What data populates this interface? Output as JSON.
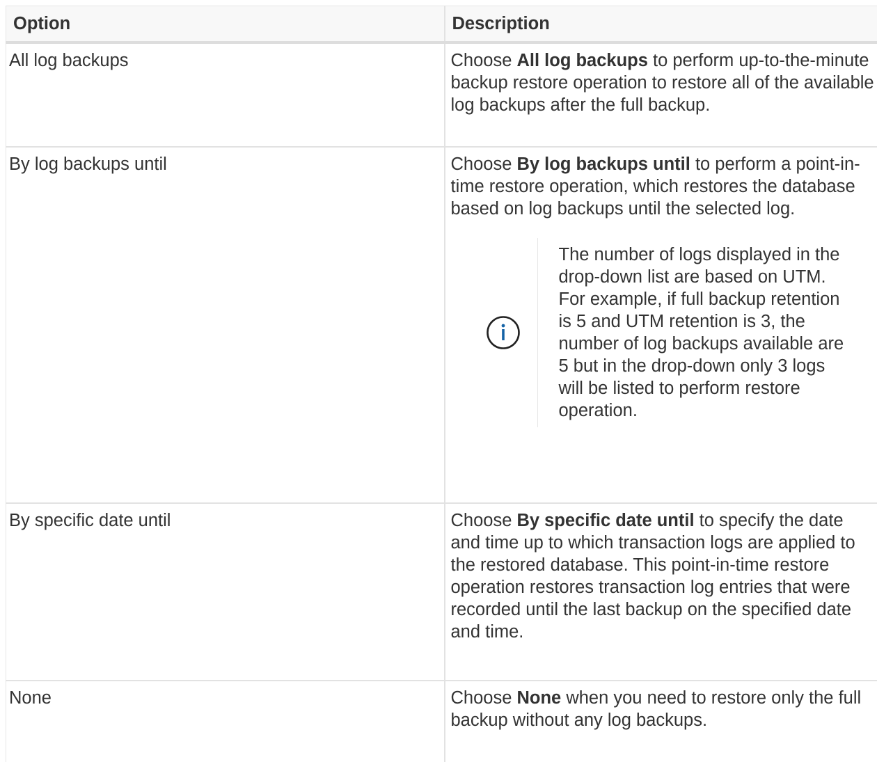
{
  "table": {
    "headers": [
      "Option",
      "Description"
    ],
    "rows": [
      {
        "option": "All log backups",
        "desc_prefix": "Choose ",
        "desc_bold": "All log backups",
        "desc_suffix": " to perform up-to-the-minute backup restore operation to restore all of the available log backups after the full backup."
      },
      {
        "option": "By log backups until",
        "desc_prefix": "Choose ",
        "desc_bold": "By log backups until",
        "desc_suffix": " to perform a point-in-time restore operation, which restores the database based on log backups until the selected log.",
        "note": "The number of logs displayed in the drop-down list are based on UTM. For example, if full backup retention is 5 and UTM retention is 3, the number of log backups available are 5 but in the drop-down only 3 logs will be listed to perform restore operation.",
        "note_icon": "info-icon"
      },
      {
        "option": "By specific date until",
        "desc_prefix": "Choose ",
        "desc_bold": "By specific date until",
        "desc_suffix": " to specify the date and time up to which transaction logs are applied to the restored database. This point-in-time restore operation restores transaction log entries that were recorded until the last backup on the specified date and time."
      },
      {
        "option": "None",
        "desc_prefix": "Choose ",
        "desc_bold": "None",
        "desc_suffix": " when you need to restore only the full backup without any log backups."
      }
    ]
  },
  "colors": {
    "text": "#333333",
    "header_bg": "#f8f8f8",
    "border": "#e2e2e2",
    "icon": "#1563a6"
  }
}
